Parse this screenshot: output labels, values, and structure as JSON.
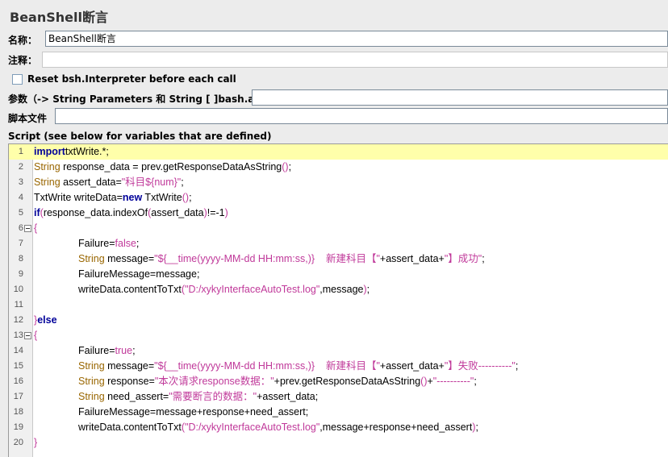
{
  "panel": {
    "title": "BeanShell断言"
  },
  "fields": {
    "name_label": "名称：",
    "name_value": "BeanShell断言",
    "comment_label": "注释：",
    "comment_value": "",
    "reset_label": "Reset bsh.Interpreter before each call",
    "reset_checked": false,
    "params_label": "参数（-> String Parameters 和 String [ ]bash.args）",
    "params_value": "",
    "script_file_label": "脚本文件",
    "script_file_value": ""
  },
  "script": {
    "label": "Script (see below for variables that are defined)",
    "current_line": 1,
    "lines": [
      {
        "n": "1",
        "fold": false,
        "indent": 0,
        "tokens": [
          [
            "kw",
            "import"
          ],
          [
            "",
            "txtWrite.*;"
          ]
        ]
      },
      {
        "n": "2",
        "fold": false,
        "indent": 0,
        "tokens": [
          [
            "ty",
            "String"
          ],
          [
            "",
            " response_data = prev.getResponseDataAsString"
          ],
          [
            "br",
            "()"
          ],
          [
            "",
            ";"
          ]
        ]
      },
      {
        "n": "3",
        "fold": false,
        "indent": 0,
        "tokens": [
          [
            "ty",
            "String"
          ],
          [
            "",
            " assert_data="
          ],
          [
            "st",
            "\"科目${num}\""
          ],
          [
            "",
            ";"
          ]
        ]
      },
      {
        "n": "4",
        "fold": false,
        "indent": 0,
        "tokens": [
          [
            "",
            "TxtWrite writeData="
          ],
          [
            "kw",
            "new"
          ],
          [
            "",
            " TxtWrite"
          ],
          [
            "br",
            "()"
          ],
          [
            "",
            ";"
          ]
        ]
      },
      {
        "n": "5",
        "fold": false,
        "indent": 0,
        "tokens": [
          [
            "kw",
            "if"
          ],
          [
            "br",
            "("
          ],
          [
            "",
            "response_data.indexOf"
          ],
          [
            "br",
            "("
          ],
          [
            "",
            "assert_data"
          ],
          [
            "br",
            ")"
          ],
          [
            "",
            "!=-1"
          ],
          [
            "br",
            ")"
          ]
        ]
      },
      {
        "n": "6",
        "fold": true,
        "indent": 0,
        "tokens": [
          [
            "br",
            "{"
          ]
        ]
      },
      {
        "n": "7",
        "fold": false,
        "indent": 1,
        "tokens": [
          [
            "",
            "Failure="
          ],
          [
            "kw",
            ""
          ],
          [
            "st",
            "false"
          ],
          [
            "",
            ";"
          ]
        ]
      },
      {
        "n": "8",
        "fold": false,
        "indent": 1,
        "tokens": [
          [
            "ty",
            "String"
          ],
          [
            "",
            " message="
          ],
          [
            "st",
            "\"${__time(yyyy-MM-dd HH:mm:ss,)}    新建科目【\""
          ],
          [
            "",
            "+assert_data+"
          ],
          [
            "st",
            "\"】成功\""
          ],
          [
            "",
            ";"
          ]
        ]
      },
      {
        "n": "9",
        "fold": false,
        "indent": 1,
        "tokens": [
          [
            "",
            "FailureMessage=message;"
          ]
        ]
      },
      {
        "n": "10",
        "fold": false,
        "indent": 1,
        "tokens": [
          [
            "",
            "writeData.contentToTxt"
          ],
          [
            "br",
            "("
          ],
          [
            "st",
            "\"D:/xykyInterfaceAutoTest.log\""
          ],
          [
            "",
            ",message"
          ],
          [
            "br",
            ")"
          ],
          [
            "",
            ";"
          ]
        ]
      },
      {
        "n": "11",
        "fold": false,
        "indent": 0,
        "tokens": []
      },
      {
        "n": "12",
        "fold": false,
        "indent": 0,
        "tokens": [
          [
            "br",
            "}"
          ],
          [
            "kw",
            "else"
          ]
        ]
      },
      {
        "n": "13",
        "fold": true,
        "indent": 0,
        "tokens": [
          [
            "br",
            "{"
          ]
        ]
      },
      {
        "n": "14",
        "fold": false,
        "indent": 1,
        "tokens": [
          [
            "",
            "Failure="
          ],
          [
            "st",
            "true"
          ],
          [
            "",
            ";"
          ]
        ]
      },
      {
        "n": "15",
        "fold": false,
        "indent": 1,
        "tokens": [
          [
            "ty",
            "String"
          ],
          [
            "",
            " message="
          ],
          [
            "st",
            "\"${__time(yyyy-MM-dd HH:mm:ss,)}    新建科目【\""
          ],
          [
            "",
            "+assert_data+"
          ],
          [
            "st",
            "\"】失败----------\""
          ],
          [
            "",
            ";"
          ]
        ]
      },
      {
        "n": "16",
        "fold": false,
        "indent": 1,
        "tokens": [
          [
            "ty",
            "String"
          ],
          [
            "",
            " response="
          ],
          [
            "st",
            "\"本次请求response数据：\""
          ],
          [
            "",
            "+prev.getResponseDataAsString"
          ],
          [
            "br",
            "()"
          ],
          [
            "",
            "+"
          ],
          [
            "st",
            "\"----------\""
          ],
          [
            "",
            ";"
          ]
        ]
      },
      {
        "n": "17",
        "fold": false,
        "indent": 1,
        "tokens": [
          [
            "ty",
            "String"
          ],
          [
            "",
            " need_assert="
          ],
          [
            "st",
            "\"需要断言的数据：\""
          ],
          [
            "",
            "+assert_data;"
          ]
        ]
      },
      {
        "n": "18",
        "fold": false,
        "indent": 1,
        "tokens": [
          [
            "",
            "FailureMessage=message+response+need_assert;"
          ]
        ]
      },
      {
        "n": "19",
        "fold": false,
        "indent": 1,
        "tokens": [
          [
            "",
            "writeData.contentToTxt"
          ],
          [
            "br",
            "("
          ],
          [
            "st",
            "\"D:/xykyInterfaceAutoTest.log\""
          ],
          [
            "",
            ",message+response+need_assert"
          ],
          [
            "br",
            ")"
          ],
          [
            "",
            ";"
          ]
        ]
      },
      {
        "n": "20",
        "fold": false,
        "indent": 0,
        "tokens": [
          [
            "br",
            "}"
          ]
        ]
      }
    ]
  }
}
